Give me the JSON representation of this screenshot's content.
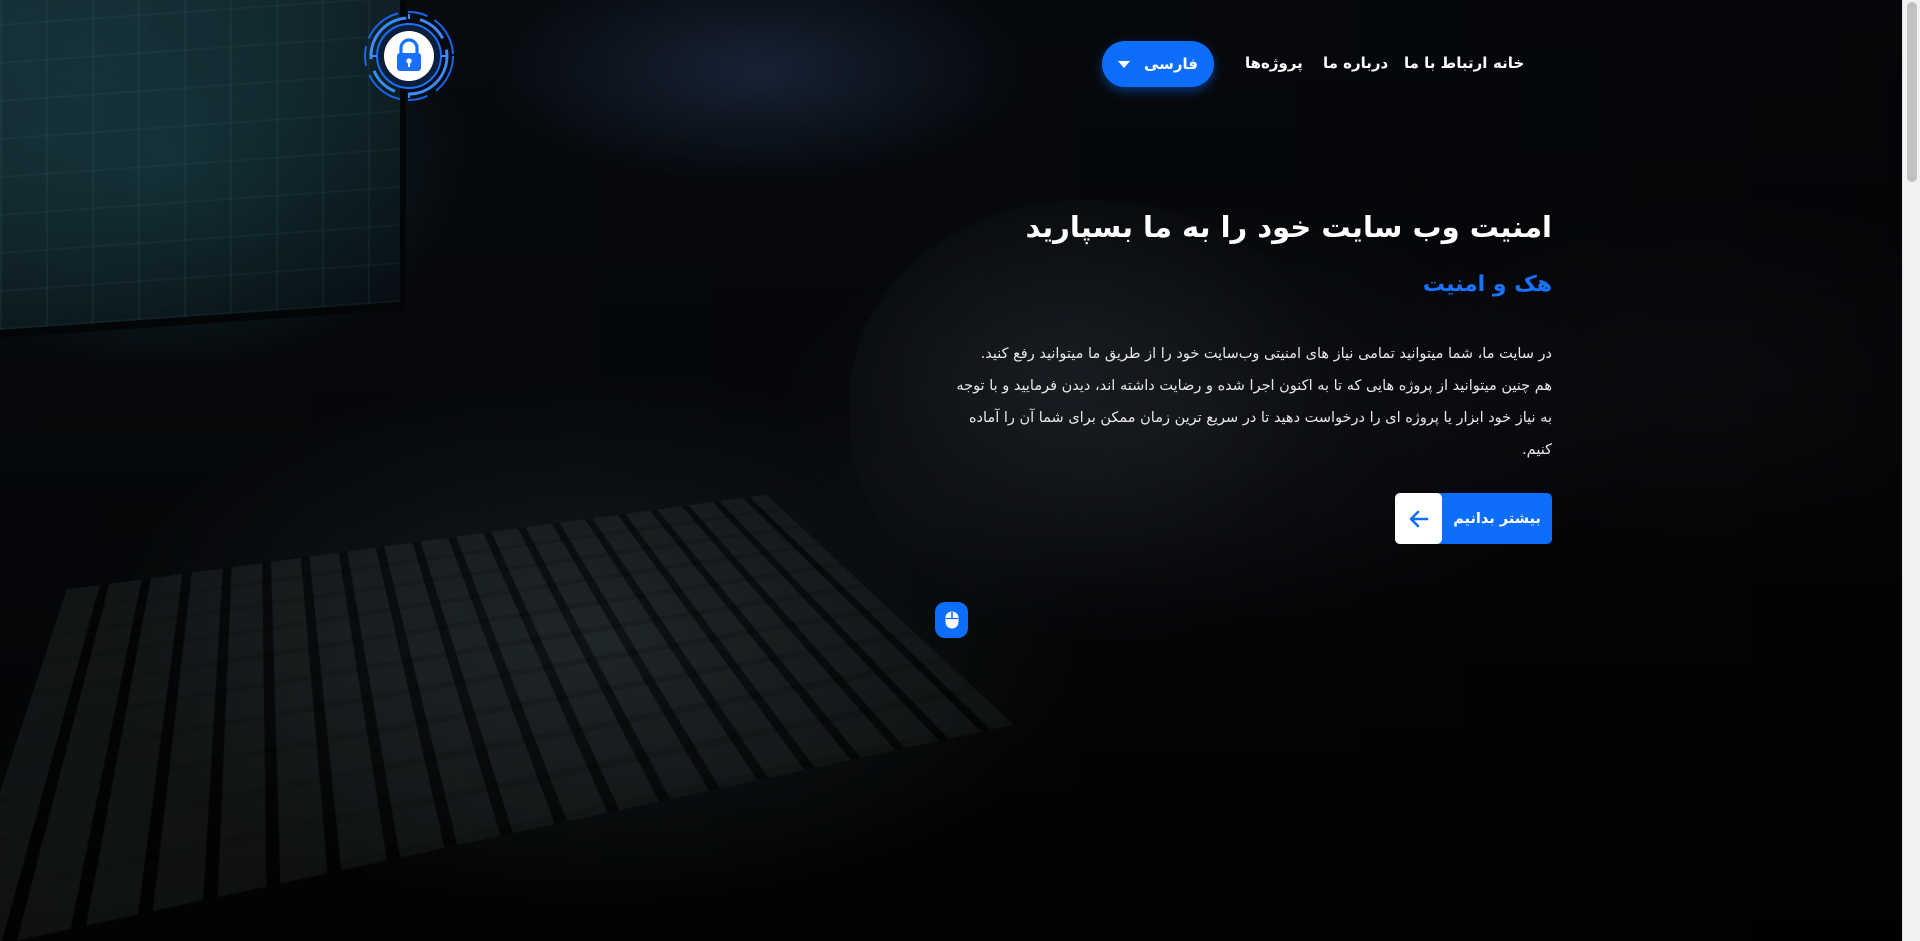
{
  "page": {
    "direction": "rtl",
    "accent_color": "#0d6efd"
  },
  "header": {
    "logo_icon": "padlock-shield-icon",
    "nav": {
      "home": "خانه",
      "contact": "ارتباط با ما",
      "about": "درباره ما",
      "projects": "پروژه‌ها"
    },
    "language": {
      "selected": "فارسی",
      "icon": "caret-down-icon"
    }
  },
  "hero": {
    "title": "امنیت وب سایت خود را به ما بسپارید",
    "subtitle": "هک و امنیت",
    "description_lines": [
      "در سایت ما، شما میتوانید تمامی نیاز های امنیتی وب‌سایت خود را از طریق ما میتوانید رفع کنید.",
      "هم چنین میتوانید از پروژه هایی که تا به اکنون اجرا شده و رضایت داشته اند، دیدن فرمایید و با توجه",
      "به نیاز خود ابزار یا پروژه ای را درخواست دهید تا در سریع ترین زمان ممکن برای شما آن را آماده",
      "کنیم."
    ],
    "cta": {
      "label": "بیشتر بدانیم",
      "icon": "arrow-left-icon"
    },
    "scroll_indicator_icon": "mouse-icon"
  }
}
